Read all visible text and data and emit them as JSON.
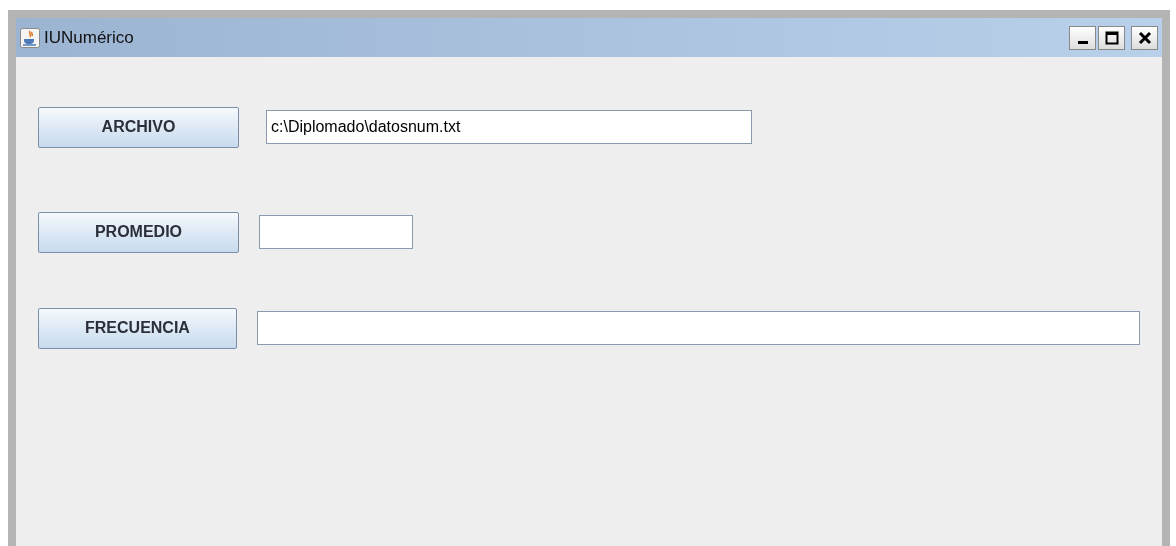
{
  "window": {
    "title": "IUNumérico"
  },
  "rows": [
    {
      "button": "ARCHIVO",
      "value": "c:\\Diplomado\\datosnum.txt"
    },
    {
      "button": "PROMEDIO",
      "value": ""
    },
    {
      "button": "FRECUENCIA",
      "value": ""
    }
  ]
}
